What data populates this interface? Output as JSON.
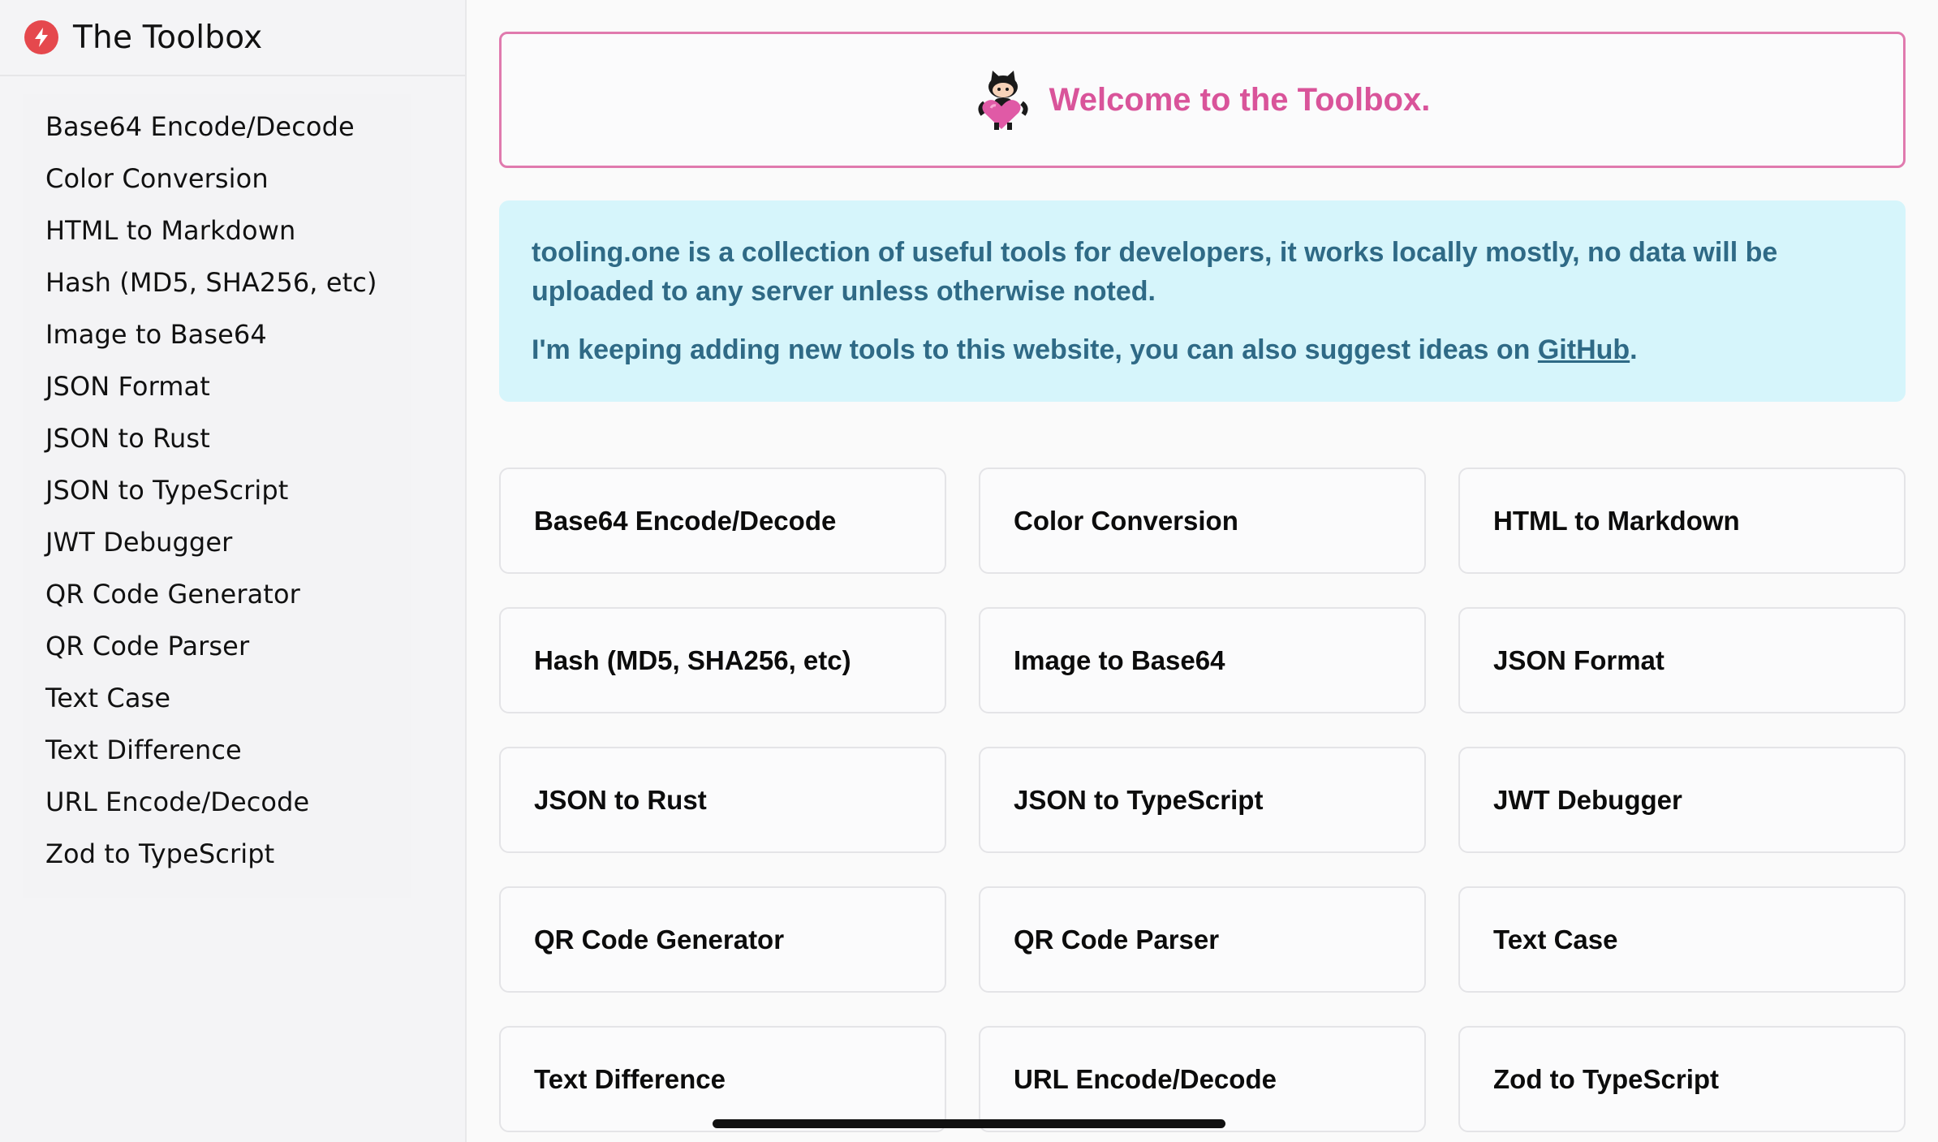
{
  "brand": {
    "title": "The Toolbox"
  },
  "sidebar": {
    "items": [
      {
        "label": "Base64 Encode/Decode"
      },
      {
        "label": "Color Conversion"
      },
      {
        "label": "HTML to Markdown"
      },
      {
        "label": "Hash (MD5, SHA256, etc)"
      },
      {
        "label": "Image to Base64"
      },
      {
        "label": "JSON Format"
      },
      {
        "label": "JSON to Rust"
      },
      {
        "label": "JSON to TypeScript"
      },
      {
        "label": "JWT Debugger"
      },
      {
        "label": "QR Code Generator"
      },
      {
        "label": "QR Code Parser"
      },
      {
        "label": "Text Case"
      },
      {
        "label": "Text Difference"
      },
      {
        "label": "URL Encode/Decode"
      },
      {
        "label": "Zod to TypeScript"
      }
    ]
  },
  "welcome": {
    "text": "Welcome to the Toolbox."
  },
  "notice": {
    "line1": "tooling.one is a collection of useful tools for developers, it works locally mostly, no data will be uploaded to any server unless otherwise noted.",
    "line2_prefix": "I'm keeping adding new tools to this website, you can also suggest ideas on ",
    "line2_link": "GitHub",
    "line2_suffix": "."
  },
  "tools": [
    {
      "label": "Base64 Encode/Decode"
    },
    {
      "label": "Color Conversion"
    },
    {
      "label": "HTML to Markdown"
    },
    {
      "label": "Hash (MD5, SHA256, etc)"
    },
    {
      "label": "Image to Base64"
    },
    {
      "label": "JSON Format"
    },
    {
      "label": "JSON to Rust"
    },
    {
      "label": "JSON to TypeScript"
    },
    {
      "label": "JWT Debugger"
    },
    {
      "label": "QR Code Generator"
    },
    {
      "label": "QR Code Parser"
    },
    {
      "label": "Text Case"
    },
    {
      "label": "Text Difference"
    },
    {
      "label": "URL Encode/Decode"
    },
    {
      "label": "Zod to TypeScript"
    }
  ],
  "colors": {
    "accent_pink": "#d9549a",
    "notice_bg": "#d6f5fb",
    "notice_text": "#2f6a86",
    "brand_red": "#e5484d"
  },
  "icons": {
    "brand": "lightning-bolt-icon",
    "mascot": "octocat-heart-icon"
  }
}
